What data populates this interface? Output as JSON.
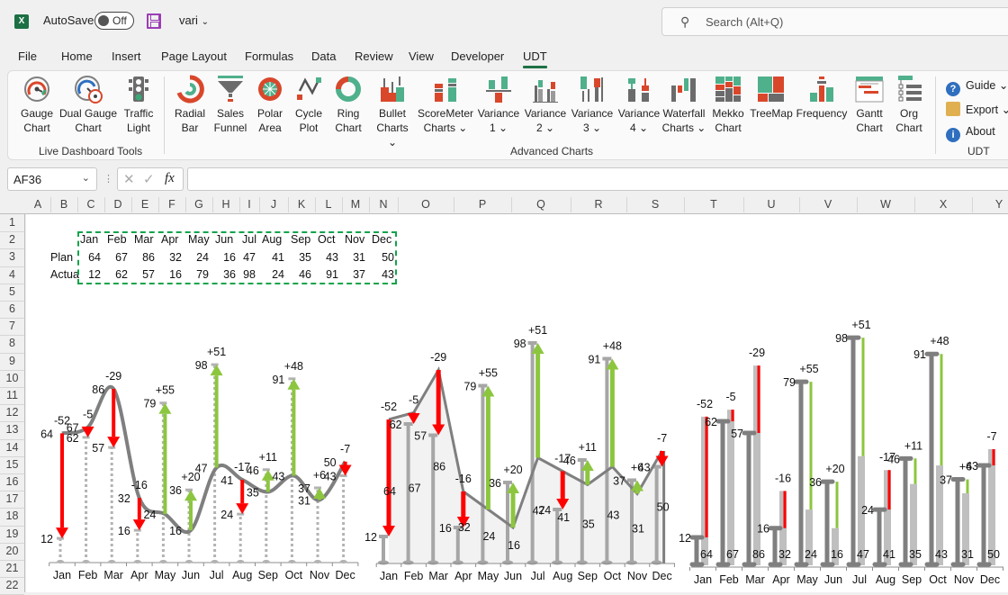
{
  "titlebar": {
    "app_icon": "excel-icon",
    "autosave_label": "AutoSave",
    "autosave_state": "Off",
    "save_icon": "save-icon",
    "filename": "vari",
    "search_placeholder": "Search (Alt+Q)"
  },
  "menu": {
    "tabs": [
      "File",
      "Home",
      "Insert",
      "Page Layout",
      "Formulas",
      "Data",
      "Review",
      "View",
      "Developer",
      "UDT"
    ],
    "active": "UDT"
  },
  "ribbon": {
    "groups": [
      {
        "label": "Live Dashboard Tools",
        "buttons": [
          {
            "line1": "Gauge",
            "line2": "Chart",
            "icon": "gauge-chart-icon"
          },
          {
            "line1": "Dual Gauge",
            "line2": "Chart",
            "icon": "dual-gauge-chart-icon"
          },
          {
            "line1": "Traffic",
            "line2": "Light",
            "icon": "traffic-light-icon"
          }
        ]
      },
      {
        "label": "Advanced Charts",
        "buttons": [
          {
            "line1": "Radial",
            "line2": "Bar",
            "icon": "radial-bar-icon"
          },
          {
            "line1": "Sales",
            "line2": "Funnel",
            "icon": "sales-funnel-icon"
          },
          {
            "line1": "Polar",
            "line2": "Area",
            "icon": "polar-area-icon"
          },
          {
            "line1": "Cycle",
            "line2": "Plot",
            "icon": "cycle-plot-icon"
          },
          {
            "line1": "Ring",
            "line2": "Chart",
            "icon": "ring-chart-icon"
          },
          {
            "line1": "Bullet",
            "line2": "Charts ⌄",
            "icon": "bullet-charts-icon"
          },
          {
            "line1": "ScoreMeter",
            "line2": "Charts ⌄",
            "icon": "scoremeter-charts-icon"
          },
          {
            "line1": "Variance",
            "line2": "1 ⌄",
            "icon": "variance-1-icon"
          },
          {
            "line1": "Variance",
            "line2": "2 ⌄",
            "icon": "variance-2-icon"
          },
          {
            "line1": "Variance",
            "line2": "3 ⌄",
            "icon": "variance-3-icon"
          },
          {
            "line1": "Variance",
            "line2": "4 ⌄",
            "icon": "variance-4-icon"
          },
          {
            "line1": "Waterfall",
            "line2": "Charts ⌄",
            "icon": "waterfall-charts-icon"
          },
          {
            "line1": "Mekko",
            "line2": "Chart",
            "icon": "mekko-chart-icon"
          },
          {
            "line1": "TreeMap",
            "line2": "",
            "icon": "treemap-icon"
          },
          {
            "line1": "Frequency",
            "line2": "",
            "icon": "frequency-icon"
          },
          {
            "line1": "Gantt",
            "line2": "Chart",
            "icon": "gantt-chart-icon"
          },
          {
            "line1": "Org",
            "line2": "Chart",
            "icon": "org-chart-icon"
          }
        ]
      },
      {
        "label": "UDT",
        "buttons": [
          {
            "line1": "Guide ⌄",
            "icon": "help-icon"
          },
          {
            "line1": "Export ⌄",
            "icon": "export-folder-icon"
          },
          {
            "line1": "About",
            "icon": "info-icon"
          }
        ]
      }
    ]
  },
  "formula_bar": {
    "name_box": "AF36",
    "fx_label": "fx",
    "formula": ""
  },
  "sheet": {
    "columns": [
      "A",
      "B",
      "C",
      "D",
      "E",
      "F",
      "G",
      "H",
      "I",
      "J",
      "K",
      "L",
      "M",
      "N",
      "O",
      "P",
      "Q",
      "R",
      "S",
      "T",
      "U",
      "V",
      "W",
      "X",
      "Y"
    ],
    "rows": [
      "1",
      "2",
      "3",
      "4",
      "5",
      "6",
      "7",
      "8",
      "9",
      "10",
      "11",
      "12",
      "13",
      "14",
      "15",
      "16",
      "17",
      "18",
      "19",
      "20",
      "21",
      "22"
    ],
    "table": {
      "months": [
        "Jan",
        "Feb",
        "Mar",
        "Apr",
        "May",
        "Jun",
        "Jul",
        "Aug",
        "Sep",
        "Oct",
        "Nov",
        "Dec"
      ],
      "plan_label": "Plan",
      "actual_label": "Actua",
      "plan": [
        64,
        67,
        86,
        32,
        24,
        16,
        47,
        41,
        35,
        43,
        31,
        50
      ],
      "actual": [
        12,
        62,
        57,
        16,
        79,
        36,
        98,
        24,
        46,
        91,
        37,
        43
      ]
    }
  },
  "colors": {
    "negative": "#ff0000",
    "positive": "#8cc63f",
    "line": "#7f7f7f",
    "plan_bar": "#bfbfbf",
    "actual_bar": "#7f7f7f",
    "selection": "#11a44b",
    "accent": "#1e7145"
  },
  "chart_data": [
    {
      "type": "line",
      "title": "",
      "variant": "smoothed plan line with dotted actual markers and variance arrows",
      "categories": [
        "Jan",
        "Feb",
        "Mar",
        "Apr",
        "May",
        "Jun",
        "Jul",
        "Aug",
        "Sep",
        "Oct",
        "Nov",
        "Dec"
      ],
      "series": [
        {
          "name": "Plan",
          "values": [
            64,
            67,
            86,
            32,
            24,
            16,
            47,
            41,
            35,
            43,
            31,
            50
          ]
        },
        {
          "name": "Actual",
          "values": [
            12,
            62,
            57,
            16,
            79,
            36,
            98,
            24,
            46,
            91,
            37,
            43
          ]
        }
      ],
      "variance_labels": [
        "-52",
        "-5",
        "-29",
        "-16",
        "+55",
        "+20",
        "+51",
        "-17",
        "+11",
        "+48",
        "+6",
        "-7"
      ],
      "ylim": [
        0,
        100
      ]
    },
    {
      "type": "area",
      "title": "",
      "variant": "plan area with actual bars and variance arrows",
      "categories": [
        "Jan",
        "Feb",
        "Mar",
        "Apr",
        "May",
        "Jun",
        "Jul",
        "Aug",
        "Sep",
        "Oct",
        "Nov",
        "Dec"
      ],
      "series": [
        {
          "name": "Plan",
          "values": [
            64,
            67,
            86,
            32,
            24,
            16,
            47,
            41,
            35,
            43,
            31,
            50
          ]
        },
        {
          "name": "Actual",
          "values": [
            12,
            62,
            57,
            16,
            79,
            36,
            98,
            24,
            46,
            91,
            37,
            43
          ]
        }
      ],
      "variance_labels": [
        "-52",
        "-5",
        "-29",
        "-16",
        "+55",
        "+20",
        "+51",
        "-17",
        "+11",
        "+48",
        "+6",
        "-7"
      ],
      "ylim": [
        0,
        100
      ]
    },
    {
      "type": "bar",
      "title": "",
      "variant": "actual vs plan bars with variance lines",
      "categories": [
        "Jan",
        "Feb",
        "Mar",
        "Apr",
        "May",
        "Jun",
        "Jul",
        "Aug",
        "Sep",
        "Oct",
        "Nov",
        "Dec"
      ],
      "series": [
        {
          "name": "Plan",
          "values": [
            64,
            67,
            86,
            32,
            24,
            16,
            47,
            41,
            35,
            43,
            31,
            50
          ]
        },
        {
          "name": "Actual",
          "values": [
            12,
            62,
            57,
            16,
            79,
            36,
            98,
            24,
            46,
            91,
            37,
            43
          ]
        }
      ],
      "variance_labels": [
        "-52",
        "-5",
        "-29",
        "-16",
        "+55",
        "+20",
        "+51",
        "-17",
        "+11",
        "+48",
        "+6",
        "-7"
      ],
      "ylim": [
        0,
        100
      ]
    }
  ]
}
